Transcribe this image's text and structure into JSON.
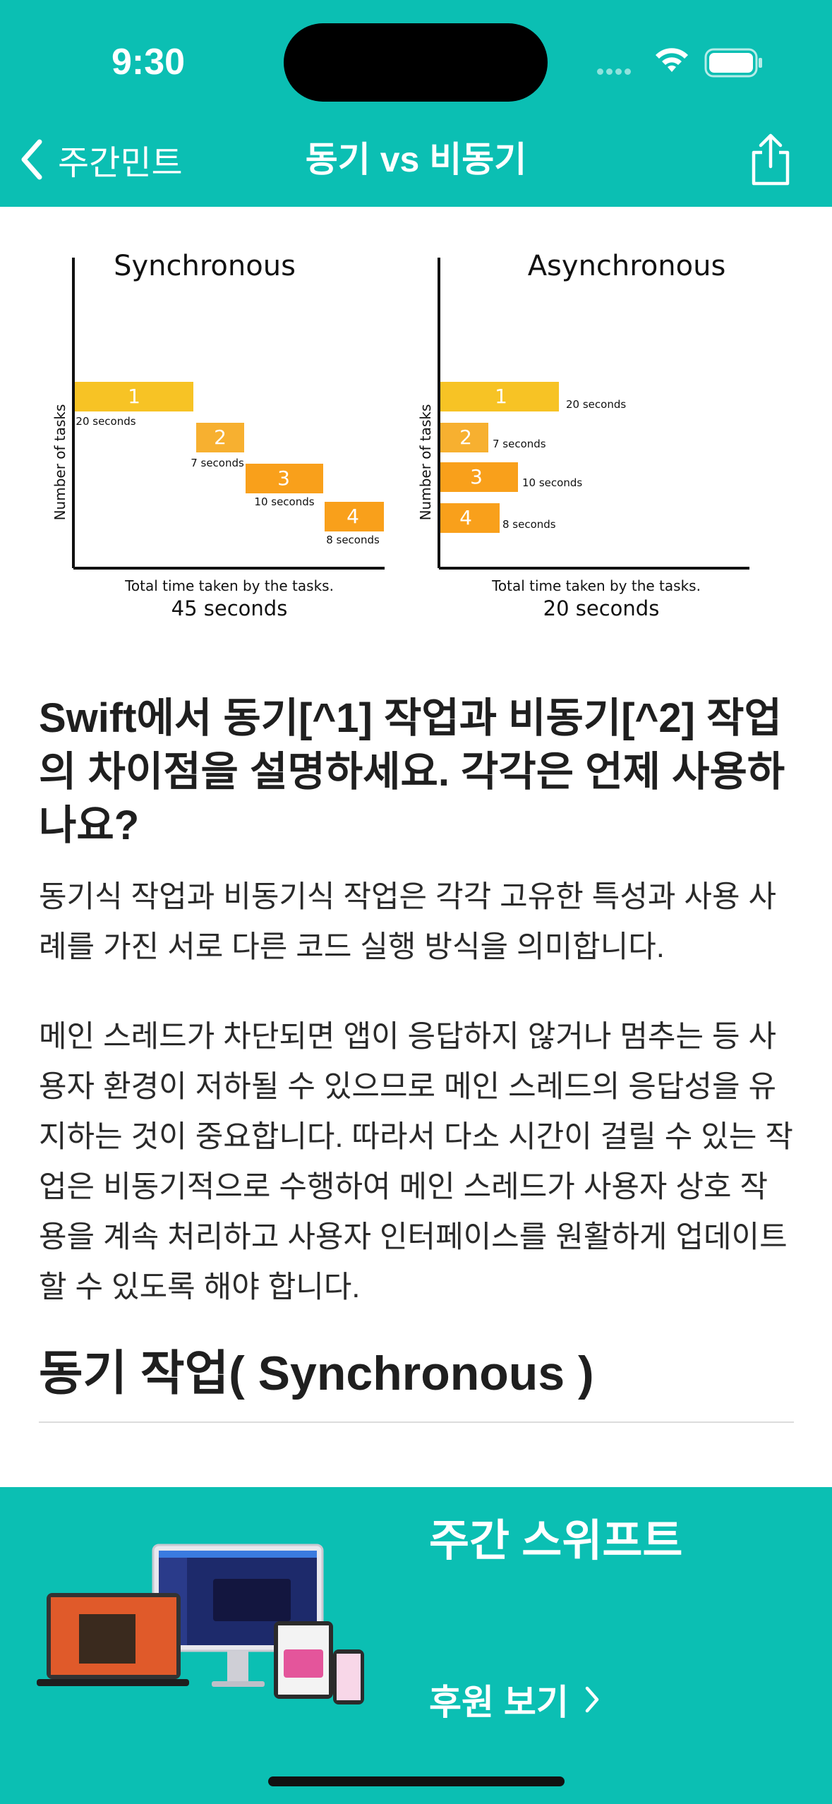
{
  "status_bar": {
    "time": "9:30"
  },
  "nav": {
    "back_label": "주간민트",
    "title": "동기 vs 비동기"
  },
  "figure": {
    "left": {
      "title": "Synchronous",
      "ylabel": "Number of tasks",
      "xlabel": "Total time taken by the tasks.",
      "total": "45 seconds",
      "tasks": [
        {
          "n": "1",
          "label": "20 seconds"
        },
        {
          "n": "2",
          "label": "7 seconds"
        },
        {
          "n": "3",
          "label": "10 seconds"
        },
        {
          "n": "4",
          "label": "8 seconds"
        }
      ]
    },
    "right": {
      "title": "Asynchronous",
      "ylabel": "Number of tasks",
      "xlabel": "Total time taken by the tasks.",
      "total": "20 seconds",
      "tasks": [
        {
          "n": "1",
          "label": "20 seconds"
        },
        {
          "n": "2",
          "label": "7 seconds"
        },
        {
          "n": "3",
          "label": "10 seconds"
        },
        {
          "n": "4",
          "label": "8 seconds"
        }
      ]
    }
  },
  "article": {
    "question": "Swift에서 동기[^1] 작업과 비동기[^2] 작업의 차이점을 설명하세요. 각각은 언제 사용하나요?",
    "paragraph1": "동기식 작업과 비동기식 작업은 각각 고유한 특성과 사용 사례를 가진 서로 다른 코드 실행 방식을 의미합니다.",
    "paragraph2": "메인 스레드가 차단되면 앱이 응답하지 않거나 멈추는 등 사용자 환경이 저하될 수 있으므로 메인 스레드의 응답성을 유지하는 것이 중요합니다. 따라서 다소 시간이 걸릴 수 있는 작업은 비동기적으로 수행하여 메인 스레드가 사용자 상호 작용을 계속 처리하고 사용자 인터페이스를 원활하게 업데이트할 수 있도록 해야 합니다.",
    "heading": "동기 작업( Synchronous )"
  },
  "banner": {
    "title": "주간 스위프트",
    "link_label": "후원 보기"
  },
  "colors": {
    "accent": "#0bbfb3",
    "bar_light": "#f7c325",
    "bar_orange": "#f9a01b"
  }
}
